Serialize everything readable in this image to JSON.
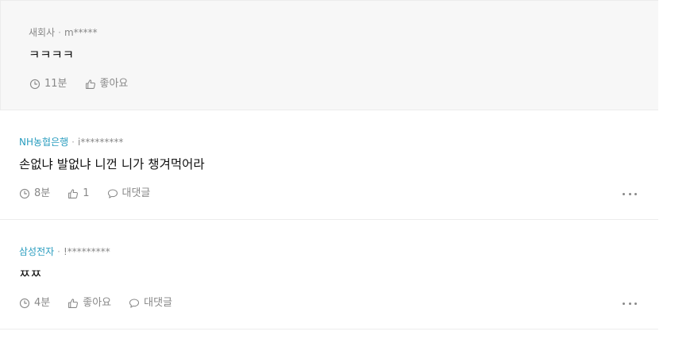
{
  "comments": [
    {
      "company": "새회사",
      "separator": "·",
      "user": "m*****",
      "text": "ㅋㅋㅋㅋ",
      "time": "11분",
      "like_label": "좋아요"
    },
    {
      "company": "NH농협은행",
      "separator": "·",
      "user": "i*********",
      "text": "손없냐 발없냐 니껀 니가 챙겨먹어라",
      "time": "8분",
      "like_label": "1",
      "reply_label": "대댓글"
    },
    {
      "company": "삼성전자",
      "separator": "·",
      "user": "!*********",
      "text": "ㅉㅉ",
      "time": "4분",
      "like_label": "좋아요",
      "reply_label": "대댓글"
    }
  ],
  "icons": {
    "clock": "clock-icon",
    "like": "thumbs-up-icon",
    "reply": "speech-bubble-icon",
    "more": "more-options-icon"
  },
  "colors": {
    "company_link": "#2a9dbf",
    "meta_gray": "#888888",
    "reply_background": "#f7f7f7",
    "divider": "#ececec"
  }
}
